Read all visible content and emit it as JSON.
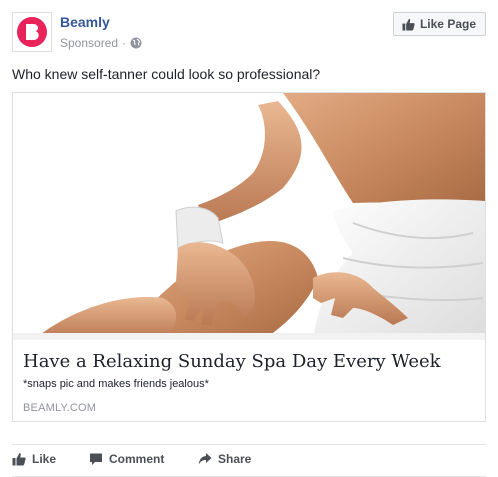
{
  "page": {
    "name": "Beamly",
    "sponsored_label": "Sponsored",
    "separator": "·",
    "logo_icon": "beamly-b-logo",
    "brand_color": "#e8245a",
    "link_color": "#365899"
  },
  "header": {
    "like_page_label": "Like Page",
    "like_page_icon": "thumbs-up-icon"
  },
  "post": {
    "text": "Who knew self-tanner could look so professional?"
  },
  "link_card": {
    "image_icon": "spa-photo",
    "headline": "Have a Relaxing Sunday Spa Day Every Week",
    "description": "*snaps pic and makes friends jealous*",
    "domain": "BEAMLY.COM"
  },
  "actions": {
    "like_label": "Like",
    "comment_label": "Comment",
    "share_label": "Share"
  }
}
